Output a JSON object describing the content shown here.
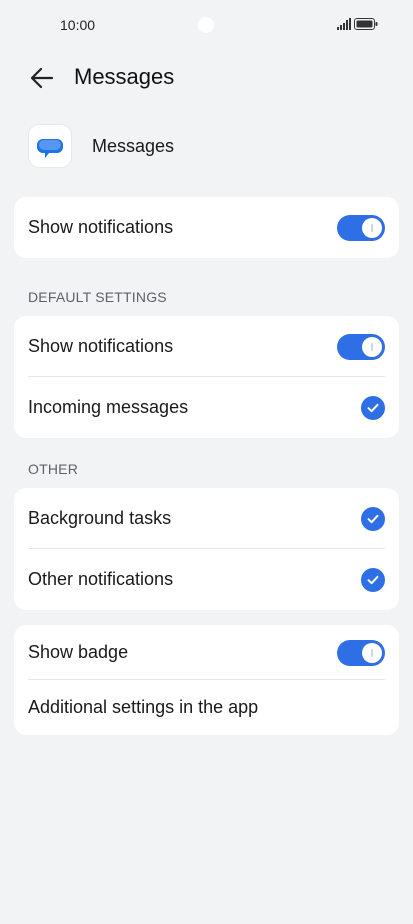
{
  "status_bar": {
    "time": "10:00",
    "icons": [
      "signal-icon",
      "battery-icon"
    ]
  },
  "header": {
    "back_icon": "back-arrow-icon",
    "title": "Messages"
  },
  "app": {
    "icon": "messages-app-icon",
    "name": "Messages"
  },
  "main_toggle": {
    "label": "Show notifications",
    "enabled": true
  },
  "default_settings": {
    "header": "DEFAULT SETTINGS",
    "items": [
      {
        "label": "Show notifications",
        "control": "toggle",
        "enabled": true
      },
      {
        "label": "Incoming messages",
        "control": "check",
        "checked": true
      }
    ]
  },
  "other": {
    "header": "OTHER",
    "items": [
      {
        "label": "Background tasks",
        "control": "check",
        "checked": true
      },
      {
        "label": "Other notifications",
        "control": "check",
        "checked": true
      }
    ]
  },
  "extra": {
    "items": [
      {
        "label": "Show badge",
        "control": "toggle",
        "enabled": true
      },
      {
        "label": "Additional settings in the app",
        "control": "link"
      }
    ]
  },
  "colors": {
    "accent": "#2f6fe6",
    "background": "#f1f3f5",
    "card": "#ffffff"
  }
}
